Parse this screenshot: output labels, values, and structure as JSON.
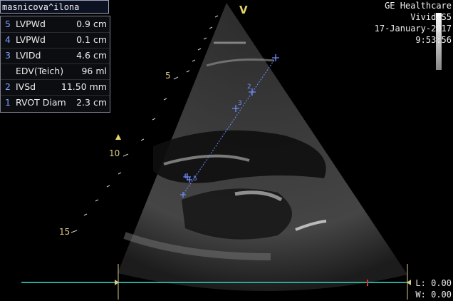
{
  "patient": {
    "name": "masnicova^ilona"
  },
  "side_icons": [
    "S",
    "U"
  ],
  "measurements": [
    {
      "num": "5",
      "label": "LVPWd",
      "value": "0.9 cm"
    },
    {
      "num": "4",
      "label": "LVPWd",
      "value": "0.1 cm"
    },
    {
      "num": "3",
      "label": "LVIDd",
      "value": "4.6 cm"
    },
    {
      "num": "",
      "label": "EDV(Teich)",
      "value": "96 ml"
    },
    {
      "num": "2",
      "label": "IVSd",
      "value": "11.50 mm"
    },
    {
      "num": "1",
      "label": "RVOT Diam",
      "value": "2.3 cm"
    }
  ],
  "vendor": {
    "company": "GE Healthcare",
    "model": "Vivid S5",
    "date": "17-January-2017",
    "time": "9:53:56"
  },
  "depth_labels": [
    "5",
    "10",
    "15"
  ],
  "orientation_marker": "V",
  "caliper_labels": [
    "1",
    "2",
    "3",
    "4",
    "5"
  ],
  "readouts": {
    "L": "L: 0.00",
    "W": "W: 0.00"
  },
  "colors": {
    "caliper": "#6f8dff",
    "timeline": "#2aa89a",
    "depth": "#d6c98a",
    "marker": "#e4d36a"
  }
}
